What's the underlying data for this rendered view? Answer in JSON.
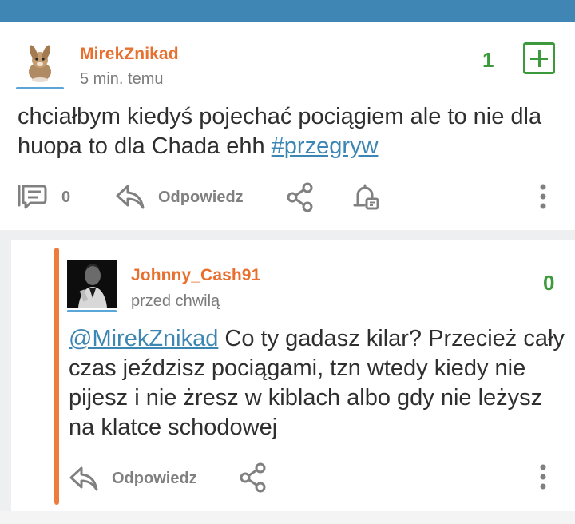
{
  "post": {
    "author": "MirekZnikad",
    "time": "5 min. temu",
    "score": "1",
    "text_main": "chciałbym kiedyś pojechać pociągiem ale to nie dla huopa to dla Chada ehh ",
    "text_tag": "#przegryw",
    "comments_count": "0",
    "reply_label": "Odpowiedz"
  },
  "reply": {
    "author": "Johnny_Cash91",
    "time": "przed chwilą",
    "score": "0",
    "mention": "@MirekZnikad",
    "text": " Co ty gadasz kilar? Przecież cały czas jeździsz pociągami, tzn wtedy kiedy nie pijesz i nie żresz w kiblach albo gdy nie leżysz na klatce schodowej",
    "reply_label": "Odpowiedz"
  },
  "colors": {
    "header": "#3f86b5",
    "username": "#e8702f",
    "score": "#3c9a3c",
    "link": "#3b86b3",
    "reply_thread_bar": "#ee7d3b"
  },
  "icons": {
    "post": [
      "comment-icon",
      "reply-arrow-icon",
      "share-icon",
      "notification-bell-icon",
      "more-vertical-icon"
    ],
    "reply": [
      "reply-arrow-icon",
      "share-icon",
      "more-vertical-icon"
    ],
    "vote": "plus-box-icon"
  }
}
